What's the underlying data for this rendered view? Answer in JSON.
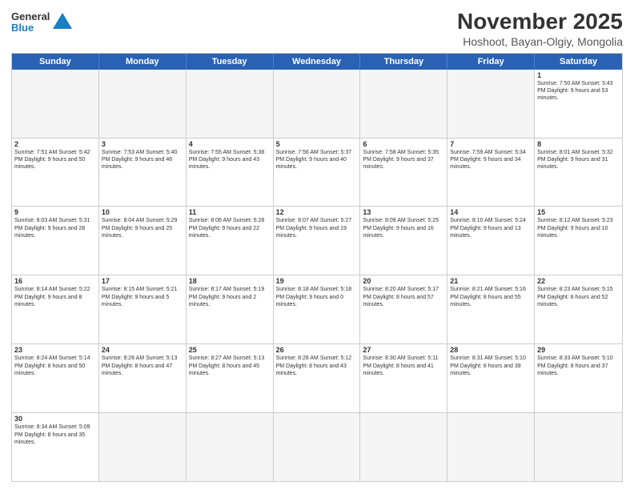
{
  "header": {
    "logo_line1": "General",
    "logo_line2": "Blue",
    "main_title": "November 2025",
    "sub_title": "Hoshoot, Bayan-Olgiy, Mongolia"
  },
  "days": [
    "Sunday",
    "Monday",
    "Tuesday",
    "Wednesday",
    "Thursday",
    "Friday",
    "Saturday"
  ],
  "rows": [
    [
      {
        "day": "",
        "info": ""
      },
      {
        "day": "",
        "info": ""
      },
      {
        "day": "",
        "info": ""
      },
      {
        "day": "",
        "info": ""
      },
      {
        "day": "",
        "info": ""
      },
      {
        "day": "",
        "info": ""
      },
      {
        "day": "1",
        "info": "Sunrise: 7:50 AM\nSunset: 5:43 PM\nDaylight: 9 hours\nand 53 minutes."
      }
    ],
    [
      {
        "day": "2",
        "info": "Sunrise: 7:51 AM\nSunset: 5:42 PM\nDaylight: 9 hours\nand 50 minutes."
      },
      {
        "day": "3",
        "info": "Sunrise: 7:53 AM\nSunset: 5:40 PM\nDaylight: 9 hours\nand 46 minutes."
      },
      {
        "day": "4",
        "info": "Sunrise: 7:55 AM\nSunset: 5:38 PM\nDaylight: 9 hours\nand 43 minutes."
      },
      {
        "day": "5",
        "info": "Sunrise: 7:56 AM\nSunset: 5:37 PM\nDaylight: 9 hours\nand 40 minutes."
      },
      {
        "day": "6",
        "info": "Sunrise: 7:58 AM\nSunset: 5:35 PM\nDaylight: 9 hours\nand 37 minutes."
      },
      {
        "day": "7",
        "info": "Sunrise: 7:59 AM\nSunset: 5:34 PM\nDaylight: 9 hours\nand 34 minutes."
      },
      {
        "day": "8",
        "info": "Sunrise: 8:01 AM\nSunset: 5:32 PM\nDaylight: 9 hours\nand 31 minutes."
      }
    ],
    [
      {
        "day": "9",
        "info": "Sunrise: 8:03 AM\nSunset: 5:31 PM\nDaylight: 9 hours\nand 28 minutes."
      },
      {
        "day": "10",
        "info": "Sunrise: 8:04 AM\nSunset: 5:29 PM\nDaylight: 9 hours\nand 25 minutes."
      },
      {
        "day": "11",
        "info": "Sunrise: 8:06 AM\nSunset: 5:28 PM\nDaylight: 9 hours\nand 22 minutes."
      },
      {
        "day": "12",
        "info": "Sunrise: 8:07 AM\nSunset: 5:27 PM\nDaylight: 9 hours\nand 19 minutes."
      },
      {
        "day": "13",
        "info": "Sunrise: 8:09 AM\nSunset: 5:25 PM\nDaylight: 9 hours\nand 16 minutes."
      },
      {
        "day": "14",
        "info": "Sunrise: 8:10 AM\nSunset: 5:24 PM\nDaylight: 9 hours\nand 13 minutes."
      },
      {
        "day": "15",
        "info": "Sunrise: 8:12 AM\nSunset: 5:23 PM\nDaylight: 9 hours\nand 10 minutes."
      }
    ],
    [
      {
        "day": "16",
        "info": "Sunrise: 8:14 AM\nSunset: 5:22 PM\nDaylight: 9 hours\nand 8 minutes."
      },
      {
        "day": "17",
        "info": "Sunrise: 8:15 AM\nSunset: 5:21 PM\nDaylight: 9 hours\nand 5 minutes."
      },
      {
        "day": "18",
        "info": "Sunrise: 8:17 AM\nSunset: 5:19 PM\nDaylight: 9 hours\nand 2 minutes."
      },
      {
        "day": "19",
        "info": "Sunrise: 8:18 AM\nSunset: 5:18 PM\nDaylight: 9 hours\nand 0 minutes."
      },
      {
        "day": "20",
        "info": "Sunrise: 8:20 AM\nSunset: 5:17 PM\nDaylight: 8 hours\nand 57 minutes."
      },
      {
        "day": "21",
        "info": "Sunrise: 8:21 AM\nSunset: 5:16 PM\nDaylight: 8 hours\nand 55 minutes."
      },
      {
        "day": "22",
        "info": "Sunrise: 8:23 AM\nSunset: 5:15 PM\nDaylight: 8 hours\nand 52 minutes."
      }
    ],
    [
      {
        "day": "23",
        "info": "Sunrise: 8:24 AM\nSunset: 5:14 PM\nDaylight: 8 hours\nand 50 minutes."
      },
      {
        "day": "24",
        "info": "Sunrise: 8:26 AM\nSunset: 5:13 PM\nDaylight: 8 hours\nand 47 minutes."
      },
      {
        "day": "25",
        "info": "Sunrise: 8:27 AM\nSunset: 5:13 PM\nDaylight: 8 hours\nand 45 minutes."
      },
      {
        "day": "26",
        "info": "Sunrise: 8:28 AM\nSunset: 5:12 PM\nDaylight: 8 hours\nand 43 minutes."
      },
      {
        "day": "27",
        "info": "Sunrise: 8:30 AM\nSunset: 5:11 PM\nDaylight: 8 hours\nand 41 minutes."
      },
      {
        "day": "28",
        "info": "Sunrise: 8:31 AM\nSunset: 5:10 PM\nDaylight: 8 hours\nand 39 minutes."
      },
      {
        "day": "29",
        "info": "Sunrise: 8:33 AM\nSunset: 5:10 PM\nDaylight: 8 hours\nand 37 minutes."
      }
    ],
    [
      {
        "day": "30",
        "info": "Sunrise: 8:34 AM\nSunset: 5:09 PM\nDaylight: 8 hours\nand 35 minutes."
      },
      {
        "day": "",
        "info": ""
      },
      {
        "day": "",
        "info": ""
      },
      {
        "day": "",
        "info": ""
      },
      {
        "day": "",
        "info": ""
      },
      {
        "day": "",
        "info": ""
      },
      {
        "day": "",
        "info": ""
      }
    ]
  ]
}
